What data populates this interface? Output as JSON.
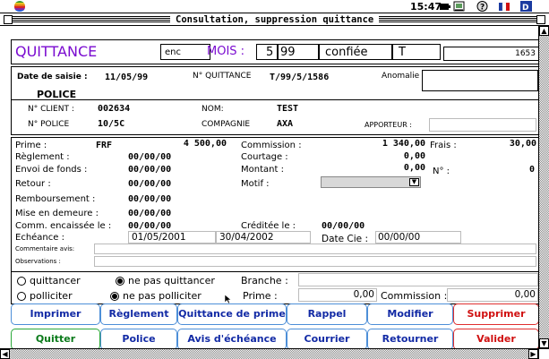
{
  "menubar": {
    "clock": "15:47"
  },
  "window": {
    "title": "Consultation, suppression quittance"
  },
  "header": {
    "title": "QUITTANCE",
    "status": "enc",
    "mois_label": "MOIS :",
    "mois_value": "5",
    "annee_value": "99",
    "etat": "confiée",
    "code": "T",
    "number": "1653"
  },
  "saisie": {
    "date_label": "Date de saisie :",
    "date_value": "11/05/99",
    "quittance_label": "N° QUITTANCE",
    "quittance_value": "T/99/5/1586",
    "anomalie_label": "Anomalie"
  },
  "police": {
    "section_label": "POLICE",
    "client_label": "N° CLIENT :",
    "client_value": "002634",
    "nom_label": "NOM:",
    "nom_value": "TEST",
    "police_label": "N° POLICE",
    "police_value": "10/5C",
    "compagnie_label": "COMPAGNIE",
    "compagnie_value": "AXA",
    "apporteur_label": "APPORTEUR :"
  },
  "details": {
    "prime_label": "Prime :",
    "prime_currency": "FRF",
    "prime_value": "4 500,00",
    "reglement_label": "Règlement :",
    "reglement_value": "00/00/00",
    "envoi_label": "Envoi de fonds :",
    "envoi_value": "00/00/00",
    "retour_label": "Retour :",
    "retour_value": "00/00/00",
    "remboursement_label": "Remboursement :",
    "remboursement_value": "00/00/00",
    "demeure_label": "Mise en demeure :",
    "demeure_value": "00/00/00",
    "comm_encaissee_label": "Comm. encaissée le :",
    "comm_encaissee_value": "00/00/00",
    "echeance_label": "Echéance :",
    "echeance_start": "01/05/2001",
    "echeance_end": "30/04/2002",
    "commentaire_label": "Commentaire avis:",
    "observations_label": "Observations :",
    "commission_label": "Commission :",
    "commission_value": "1 340,00",
    "frais_label": "Frais :",
    "frais_value": "30,00",
    "courtage_label": "Courtage :",
    "courtage_value": "0,00",
    "montant_label": "Montant :",
    "montant_value": "0,00",
    "no_label": "N° :",
    "no_value": "0",
    "motif_label": "Motif :",
    "creditee_label": "Créditée le :",
    "creditee_value": "00/00/00",
    "date_cie_label": "Date Cie :",
    "date_cie_value": "00/00/00"
  },
  "options": {
    "quittancer": "quittancer",
    "ne_pas_quittancer": "ne pas quittancer",
    "branche_label": "Branche :",
    "polliciter": "polliciter",
    "ne_pas_polliciter": "ne pas polliciter",
    "prime_label": "Prime :",
    "prime_value": "0,00",
    "commission_label": "Commission :",
    "commission_value": "0,00"
  },
  "buttons": {
    "imprimer": "Imprimer",
    "reglement": "Règlement",
    "quittance_prime": "Quittance de prime",
    "rappel": "Rappel",
    "modifier": "Modifier",
    "supprimer": "Supprimer",
    "quitter": "Quitter",
    "police": "Police",
    "avis_echeance": "Avis d'échéance",
    "courrier": "Courrier",
    "retourner": "Retourner",
    "valider": "Valider"
  },
  "colors": {
    "accent_purple": "#7a0bd0",
    "button_blue": "#122aa5",
    "button_red": "#d01010",
    "button_green": "#0a7a1a"
  }
}
